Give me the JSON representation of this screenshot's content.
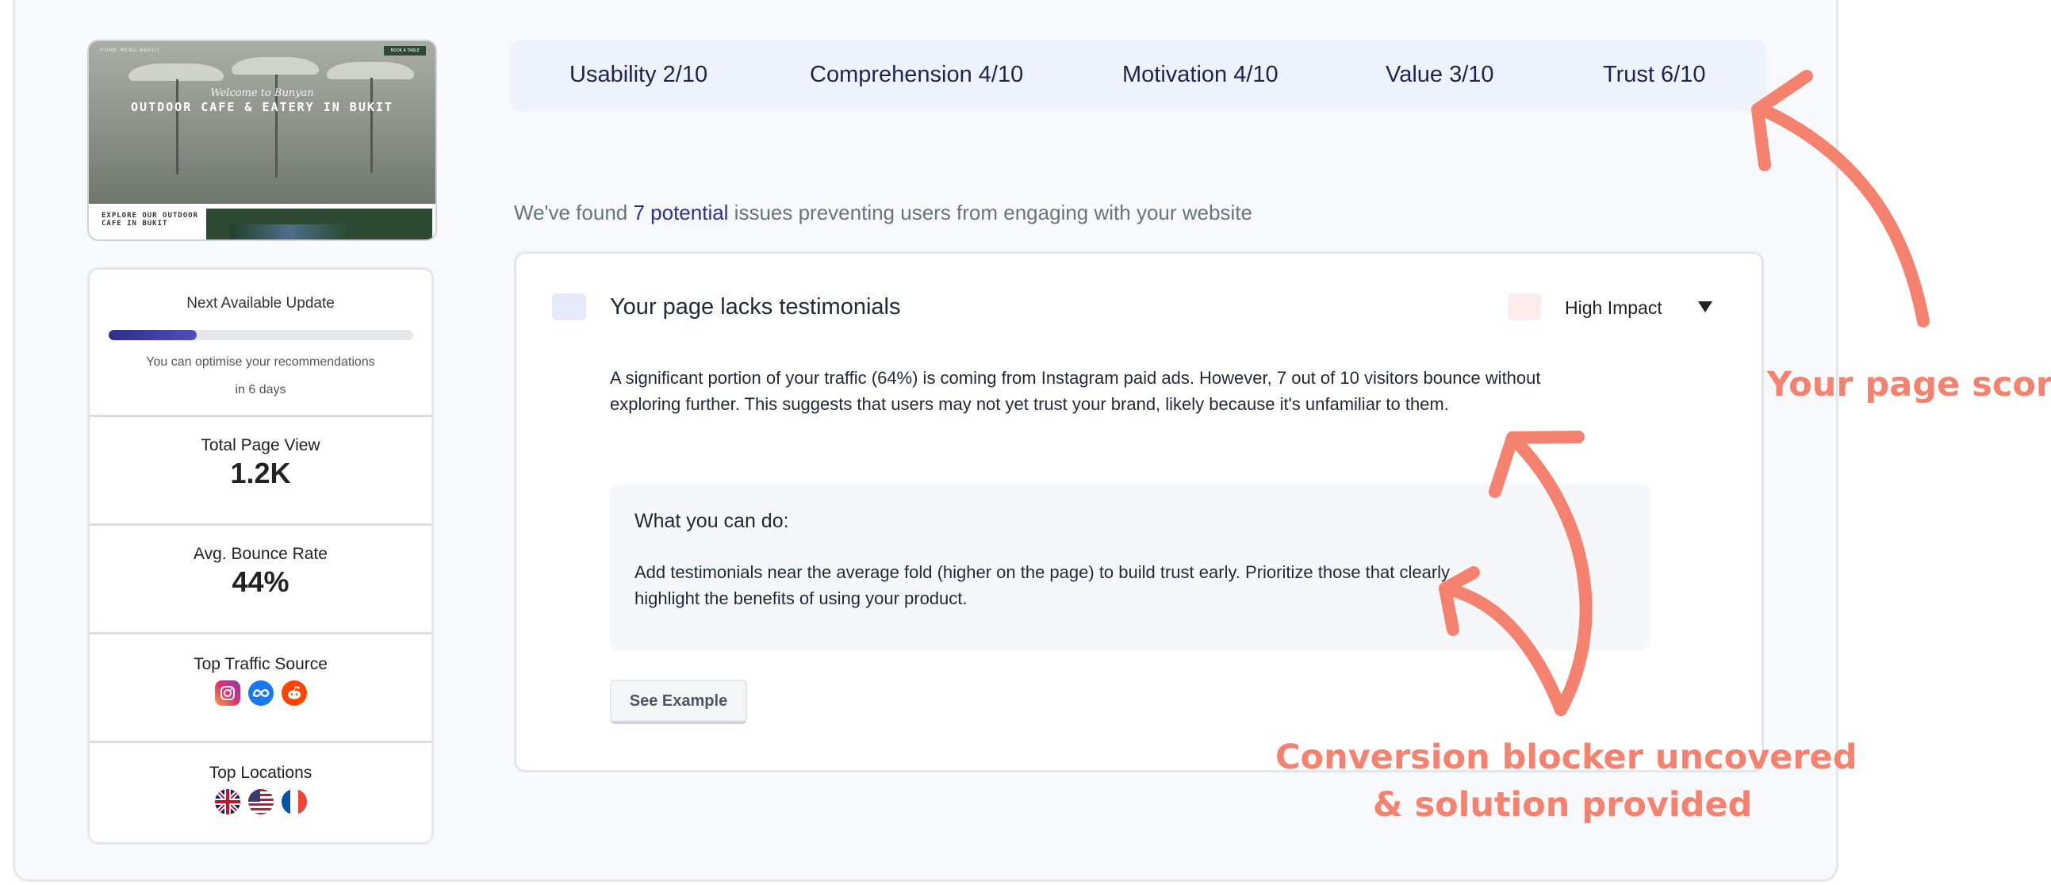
{
  "thumbnail": {
    "nav_text": "HOME   MENU   ABOUT",
    "cta": "BOOK A TABLE",
    "script_title": "Welcome to Bunyan",
    "title": "OUTDOOR CAFE & EATERY IN BUKIT",
    "explore": "EXPLORE OUR OUTDOOR CAFE IN BUKIT"
  },
  "stats": {
    "update": {
      "label": "Next Available Update",
      "progress": 0.29,
      "text_line1": "You can optimise your recommendations",
      "text_line2": "in 6 days"
    },
    "page_view": {
      "label": "Total Page View",
      "value": "1.2K"
    },
    "bounce": {
      "label": "Avg. Bounce Rate",
      "value": "44%"
    },
    "traffic": {
      "label": "Top Traffic Source",
      "icons": [
        "instagram-icon",
        "meta-icon",
        "reddit-icon"
      ]
    },
    "locations": {
      "label": "Top Locations",
      "icons": [
        "uk-flag-icon",
        "us-flag-icon",
        "france-flag-icon"
      ]
    }
  },
  "scores": [
    {
      "label": "Usability 2/10"
    },
    {
      "label": "Comprehension 4/10"
    },
    {
      "label": "Motivation 4/10"
    },
    {
      "label": "Value 3/10"
    },
    {
      "label": "Trust 6/10"
    }
  ],
  "found": {
    "prefix": "We've found ",
    "highlight": "7 potential",
    "suffix": " issues preventing users from engaging with your website"
  },
  "issue": {
    "title": "Your page lacks testimonials",
    "impact": "High Impact",
    "description": "A significant portion of your traffic (64%) is coming from Instagram paid ads. However, 7 out of 10 visitors bounce without exploring further. This suggests that users may not yet trust your brand, likely because it's unfamiliar to them.",
    "todo_heading": "What you can do:",
    "todo_text": "Add testimonials near the average fold (higher on the page) to build trust early. Prioritize those that clearly highlight the benefits of using your product.",
    "example_button": "See Example"
  },
  "annotations": {
    "score": "Your page score",
    "blocker_line1": "Conversion blocker uncovered",
    "blocker_line2": "& solution provided"
  },
  "colors": {
    "accent": "#2e2f8f",
    "annotation": "#f4826f",
    "score_bg": "#edf2fd"
  }
}
